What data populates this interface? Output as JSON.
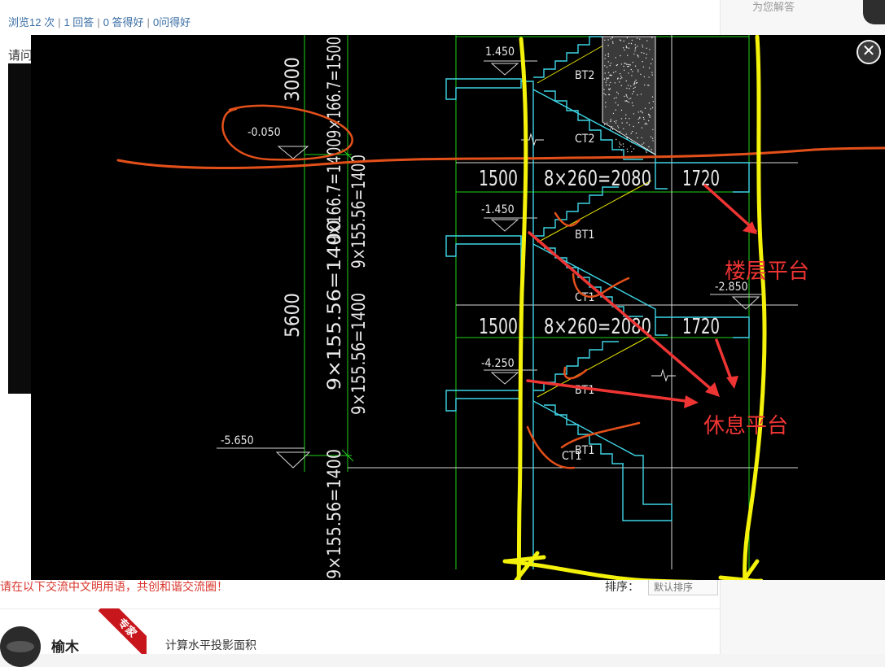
{
  "stats": {
    "views": "浏览12 次",
    "answers": "1 回答",
    "answer_good": "0 答得好",
    "question_good": "0问得好"
  },
  "side": {
    "search_placeholder": "为您解答"
  },
  "question": {
    "label": "请问"
  },
  "comments": {
    "notice": "请在以下交流中文明用语，共创和谐交流圈！",
    "sort_label": "排序：",
    "sort_value": "默认排序"
  },
  "answer": {
    "user_name": "榆木",
    "badge": "专家",
    "text": "计算水平投影面积"
  },
  "lightbox": {
    "close_label": "✕",
    "drawing": {
      "elevations": [
        "1.450",
        "-0.050",
        "-1.450",
        "-2.850",
        "-4.250",
        "-5.650"
      ],
      "dims_vertical": [
        "3000",
        "5600",
        "9×166.7=1500",
        "9×166.7=1400",
        "9×155.56=1400",
        "9×155.56=1400",
        "9×155.56=1400",
        "9×155.56=1400"
      ],
      "dims_horizontal": [
        "1500",
        "8×260=2080",
        "1720",
        "1500",
        "8×260=2080",
        "1720"
      ],
      "stair_labels": [
        "BT2",
        "CT2",
        "BT1",
        "CT1",
        "BT1",
        "CT1",
        "BT1"
      ],
      "annotation_floor_platform": "楼层平台",
      "annotation_rest_platform": "休息平台"
    }
  },
  "colors": {
    "cad_green": "#21d21a",
    "cad_cyan": "#3ed6e6",
    "cad_white": "#e9e9e9",
    "annotation_yellow": "#f4f20a",
    "annotation_orange": "#e4501a",
    "annotation_red": "#ef3434"
  }
}
